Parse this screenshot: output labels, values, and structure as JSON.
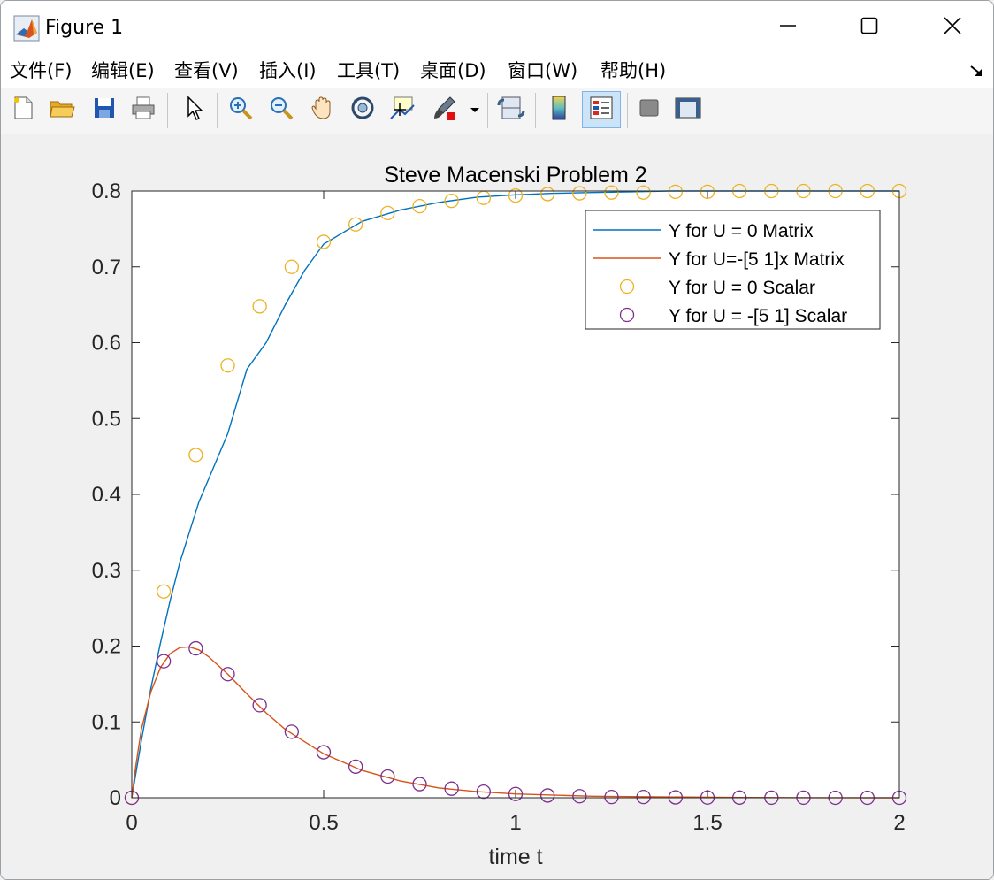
{
  "window": {
    "title": "Figure 1",
    "controls": [
      "minimize",
      "maximize",
      "close"
    ]
  },
  "menu": [
    {
      "label": "文件(F)"
    },
    {
      "label": "编辑(E)"
    },
    {
      "label": "查看(V)"
    },
    {
      "label": "插入(I)"
    },
    {
      "label": "工具(T)"
    },
    {
      "label": "桌面(D)"
    },
    {
      "label": "窗口(W)"
    },
    {
      "label": "帮助(H)"
    }
  ],
  "toolbar": {
    "tools": [
      "new-figure",
      "open-file",
      "save",
      "print",
      "edit-plot",
      "zoom-in",
      "zoom-out",
      "pan",
      "rotate-3d",
      "data-cursor",
      "brush",
      "brush-menu",
      "link-plot",
      "insert-colorbar",
      "insert-legend",
      "hide-plot-tools",
      "show-plot-tools"
    ],
    "active": "insert-legend"
  },
  "chart_data": {
    "type": "line",
    "title": "Steve Macenski Problem 2",
    "xlabel": "time t",
    "ylabel": "",
    "xlim": [
      0,
      2
    ],
    "ylim": [
      0,
      0.8
    ],
    "xticks": [
      "0",
      "0.5",
      "1",
      "1.5",
      "2"
    ],
    "yticks": [
      "0",
      "0.1",
      "0.2",
      "0.3",
      "0.4",
      "0.5",
      "0.6",
      "0.7",
      "0.8"
    ],
    "grid": false,
    "legend_position": "top-right",
    "colors": {
      "series1": "#0072bd",
      "series2": "#d95319",
      "series3": "#edb120",
      "series4": "#7e2f8e"
    },
    "series": [
      {
        "name": "Y for U = 0 Matrix",
        "style": "line",
        "x": [
          0,
          0.025,
          0.05,
          0.075,
          0.1,
          0.125,
          0.15,
          0.175,
          0.2,
          0.25,
          0.3,
          0.35,
          0.4,
          0.45,
          0.5,
          0.6,
          0.7,
          0.8,
          0.9,
          1.0,
          1.1,
          1.2,
          1.3,
          1.4,
          1.5,
          1.6,
          1.7,
          1.8,
          1.9,
          2.0
        ],
        "y": [
          0,
          0.075,
          0.145,
          0.205,
          0.26,
          0.31,
          0.35,
          0.39,
          0.42,
          0.48,
          0.565,
          0.6,
          0.65,
          0.695,
          0.73,
          0.76,
          0.775,
          0.785,
          0.792,
          0.795,
          0.797,
          0.798,
          0.799,
          0.8,
          0.8,
          0.8,
          0.8,
          0.8,
          0.8,
          0.8
        ]
      },
      {
        "name": "Y for U=-[5 1]x Matrix",
        "style": "line",
        "x": [
          0,
          0.01,
          0.025,
          0.05,
          0.075,
          0.1,
          0.125,
          0.15,
          0.175,
          0.2,
          0.25,
          0.3,
          0.35,
          0.4,
          0.5,
          0.6,
          0.7,
          0.8,
          0.9,
          1.0,
          1.2,
          1.4,
          1.6,
          1.8,
          2.0
        ],
        "y": [
          0,
          0.04,
          0.09,
          0.14,
          0.172,
          0.19,
          0.198,
          0.199,
          0.195,
          0.186,
          0.163,
          0.137,
          0.112,
          0.09,
          0.058,
          0.036,
          0.022,
          0.013,
          0.008,
          0.005,
          0.002,
          0.001,
          0.0003,
          0.0001,
          0
        ]
      },
      {
        "name": "Y for U = 0 Scalar",
        "style": "marker-circle",
        "x": [
          0,
          0.0833,
          0.1667,
          0.25,
          0.3333,
          0.4167,
          0.5,
          0.5833,
          0.6667,
          0.75,
          0.8333,
          0.9167,
          1.0,
          1.0833,
          1.1667,
          1.25,
          1.3333,
          1.4167,
          1.5,
          1.5833,
          1.6667,
          1.75,
          1.8333,
          1.9167,
          2.0
        ],
        "y": [
          0,
          0.272,
          0.452,
          0.57,
          0.648,
          0.7,
          0.733,
          0.756,
          0.771,
          0.78,
          0.787,
          0.791,
          0.794,
          0.796,
          0.797,
          0.798,
          0.798,
          0.799,
          0.799,
          0.8,
          0.8,
          0.8,
          0.8,
          0.8,
          0.8
        ]
      },
      {
        "name": "Y for U = -[5 1] Scalar",
        "style": "marker-circle",
        "x": [
          0,
          0.0833,
          0.1667,
          0.25,
          0.3333,
          0.4167,
          0.5,
          0.5833,
          0.6667,
          0.75,
          0.8333,
          0.9167,
          1.0,
          1.0833,
          1.1667,
          1.25,
          1.3333,
          1.4167,
          1.5,
          1.5833,
          1.6667,
          1.75,
          1.8333,
          1.9167,
          2.0
        ],
        "y": [
          0,
          0.18,
          0.197,
          0.163,
          0.122,
          0.087,
          0.06,
          0.041,
          0.028,
          0.018,
          0.012,
          0.008,
          0.005,
          0.003,
          0.002,
          0.001,
          0.001,
          0.0005,
          0.0003,
          0.0002,
          0.0001,
          0.0001,
          0,
          0,
          0
        ]
      }
    ]
  }
}
